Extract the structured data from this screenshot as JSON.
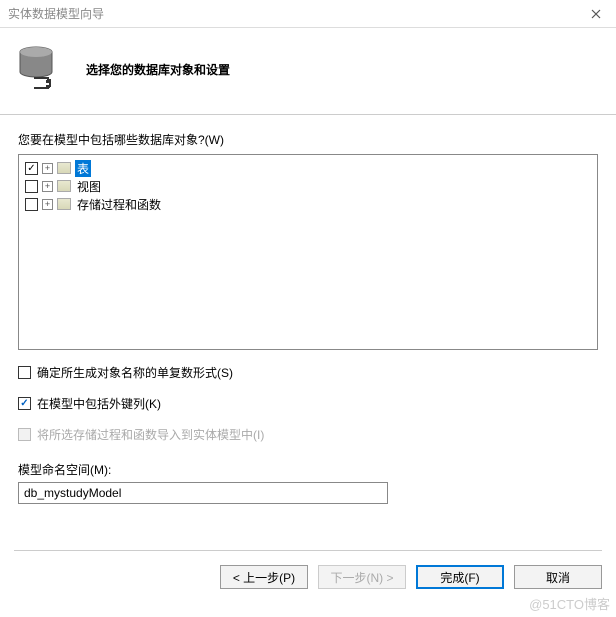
{
  "window": {
    "title": "实体数据模型向导"
  },
  "header": {
    "title": "选择您的数据库对象和设置"
  },
  "tree": {
    "prompt": "您要在模型中包括哪些数据库对象?(W)",
    "items": [
      {
        "label": "表",
        "checked": true,
        "selected": true
      },
      {
        "label": "视图",
        "checked": false,
        "selected": false
      },
      {
        "label": "存储过程和函数",
        "checked": false,
        "selected": false
      }
    ]
  },
  "options": {
    "pluralize": {
      "label": "确定所生成对象名称的单复数形式(S)",
      "checked": false,
      "disabled": false
    },
    "foreignkeys": {
      "label": "在模型中包括外键列(K)",
      "checked": true,
      "disabled": false
    },
    "importsp": {
      "label": "将所选存储过程和函数导入到实体模型中(I)",
      "checked": false,
      "disabled": true
    }
  },
  "namespace": {
    "label": "模型命名空间(M):",
    "value": "db_mystudyModel"
  },
  "buttons": {
    "back": "< 上一步(P)",
    "next": "下一步(N) >",
    "finish": "完成(F)",
    "cancel": "取消"
  },
  "watermark": "@51CTO博客"
}
